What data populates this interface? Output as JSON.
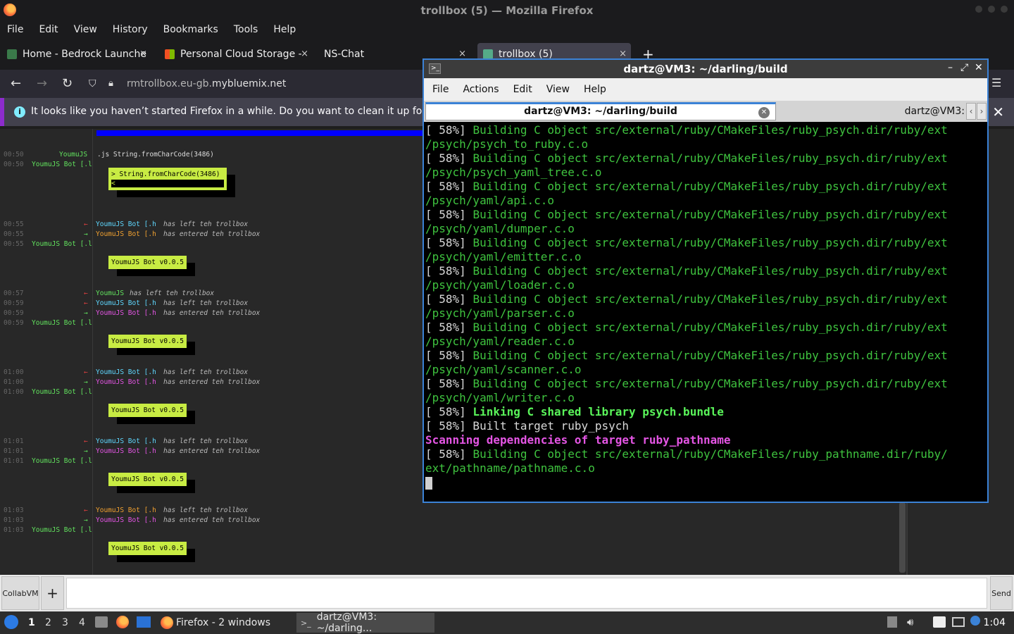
{
  "firefox": {
    "window_title": "trollbox (5) — Mozilla Firefox",
    "menu": [
      "File",
      "Edit",
      "View",
      "History",
      "Bookmarks",
      "Tools",
      "Help"
    ],
    "tabs": [
      {
        "label": "Home - Bedrock Launche",
        "close": "×"
      },
      {
        "label": "Personal Cloud Storage -",
        "close": "×"
      },
      {
        "label": "NS-Chat",
        "close": "×"
      },
      {
        "label": "trollbox (5)",
        "close": "×"
      }
    ],
    "new_tab": "+",
    "url_prefix": "rmtrollbox.eu-gb.",
    "url_domain": "mybluemix.net",
    "notice": "It looks like you haven’t started Firefox in a while. Do you want to clean it up for a f",
    "notice_close": "✕"
  },
  "chat": {
    "blocks": [
      {
        "time": "00:50",
        "nick": "YoumuJS",
        "text": ".js String.fromCharCode(3486)"
      },
      {
        "time": "00:50",
        "nick": "YoumuJS Bot [.l",
        "box": "> String.fromCharCode(3486)",
        "box2": "<"
      },
      {
        "time": "00:55",
        "event_nick": "YoumuJS Bot [.h",
        "event": "has left teh trollbox",
        "arrow": "←"
      },
      {
        "time": "00:55",
        "event_nick": "YoumuJS Bot [.h",
        "event": "has entered teh trollbox",
        "arrow": "→"
      },
      {
        "time": "00:55",
        "nick": "YoumuJS Bot [.l",
        "box": "YoumuJS Bot v0.0.5"
      },
      {
        "time": "00:57",
        "event_nick": "YoumuJS",
        "event": "has left teh trollbox",
        "arrow": "←"
      },
      {
        "time": "00:59",
        "event_nick": "YoumuJS Bot [.h",
        "event": "has left teh trollbox",
        "arrow": "←"
      },
      {
        "time": "00:59",
        "event_nick": "YoumuJS Bot [.h",
        "event": "has entered teh trollbox",
        "arrow": "→"
      },
      {
        "time": "00:59",
        "nick": "YoumuJS Bot [.l",
        "box": "YoumuJS Bot v0.0.5"
      },
      {
        "time": "01:00",
        "event_nick": "YoumuJS Bot [.h",
        "event": "has left teh trollbox",
        "arrow": "←"
      },
      {
        "time": "01:00",
        "event_nick": "YoumuJS Bot [.h",
        "event": "has entered teh trollbox",
        "arrow": "→"
      },
      {
        "time": "01:00",
        "nick": "YoumuJS Bot [.l",
        "box": "YoumuJS Bot v0.0.5"
      },
      {
        "time": "01:01",
        "event_nick": "YoumuJS Bot [.h",
        "event": "has left teh trollbox",
        "arrow": "←"
      },
      {
        "time": "01:01",
        "event_nick": "YoumuJS Bot [.h",
        "event": "has entered teh trollbox",
        "arrow": "→"
      },
      {
        "time": "01:01",
        "nick": "YoumuJS Bot [.l",
        "box": "YoumuJS Bot v0.0.5"
      },
      {
        "time": "01:03",
        "event_nick": "YoumuJS Bot [.h",
        "event": "has left teh trollbox",
        "arrow": "←"
      },
      {
        "time": "01:03",
        "event_nick": "YoumuJS Bot [.h",
        "event": "has entered teh trollbox",
        "arrow": "→"
      },
      {
        "time": "01:03",
        "nick": "YoumuJS Bot [.l",
        "box": "YoumuJS Bot v0.0.5"
      }
    ],
    "vm_button": "CollabVM",
    "plus_button": "+",
    "send_button": "Send"
  },
  "terminal": {
    "title": "dartz@VM3: ~/darling/build",
    "menu": [
      "File",
      "Actions",
      "Edit",
      "View",
      "Help"
    ],
    "tab1": "dartz@VM3: ~/darling/build",
    "tab2": "dartz@VM3:",
    "lines": [
      {
        "p": "[ 58%] ",
        "g": "Building C object src/external/ruby/CMakeFiles/ruby_psych.dir/ruby/ext"
      },
      {
        "g": "/psych/psych_to_ruby.c.o"
      },
      {
        "p": "[ 58%] ",
        "g": "Building C object src/external/ruby/CMakeFiles/ruby_psych.dir/ruby/ext"
      },
      {
        "g": "/psych/psych_yaml_tree.c.o"
      },
      {
        "p": "[ 58%] ",
        "g": "Building C object src/external/ruby/CMakeFiles/ruby_psych.dir/ruby/ext"
      },
      {
        "g": "/psych/yaml/api.c.o"
      },
      {
        "p": "[ 58%] ",
        "g": "Building C object src/external/ruby/CMakeFiles/ruby_psych.dir/ruby/ext"
      },
      {
        "g": "/psych/yaml/dumper.c.o"
      },
      {
        "p": "[ 58%] ",
        "g": "Building C object src/external/ruby/CMakeFiles/ruby_psych.dir/ruby/ext"
      },
      {
        "g": "/psych/yaml/emitter.c.o"
      },
      {
        "p": "[ 58%] ",
        "g": "Building C object src/external/ruby/CMakeFiles/ruby_psych.dir/ruby/ext"
      },
      {
        "g": "/psych/yaml/loader.c.o"
      },
      {
        "p": "[ 58%] ",
        "g": "Building C object src/external/ruby/CMakeFiles/ruby_psych.dir/ruby/ext"
      },
      {
        "g": "/psych/yaml/parser.c.o"
      },
      {
        "p": "[ 58%] ",
        "g": "Building C object src/external/ruby/CMakeFiles/ruby_psych.dir/ruby/ext"
      },
      {
        "g": "/psych/yaml/reader.c.o"
      },
      {
        "p": "[ 58%] ",
        "g": "Building C object src/external/ruby/CMakeFiles/ruby_psych.dir/ruby/ext"
      },
      {
        "g": "/psych/yaml/scanner.c.o"
      },
      {
        "p": "[ 58%] ",
        "g": "Building C object src/external/ruby/CMakeFiles/ruby_psych.dir/ruby/ext"
      },
      {
        "g": "/psych/yaml/writer.c.o"
      },
      {
        "p": "[ 58%] ",
        "gb": "Linking C shared library psych.bundle"
      },
      {
        "p": "[ 58%] Built target ruby_psych"
      },
      {
        "mb": "Scanning dependencies of target ruby_pathname"
      },
      {
        "p": "[ 58%] ",
        "g": "Building C object src/external/ruby/CMakeFiles/ruby_pathname.dir/ruby/"
      },
      {
        "g": "ext/pathname/pathname.c.o"
      }
    ]
  },
  "taskbar": {
    "workspaces": [
      "1",
      "2",
      "3",
      "4"
    ],
    "firefox_task": "Firefox - 2 windows",
    "terminal_task": "dartz@VM3: ~/darling...",
    "clock": "1:04"
  },
  "colors": {
    "accent": "#3b82d6",
    "chat_nick": "#62e35e",
    "bot_box": "#c8ec43",
    "term_green": "#3fc33f",
    "term_magenta": "#e455e4"
  }
}
